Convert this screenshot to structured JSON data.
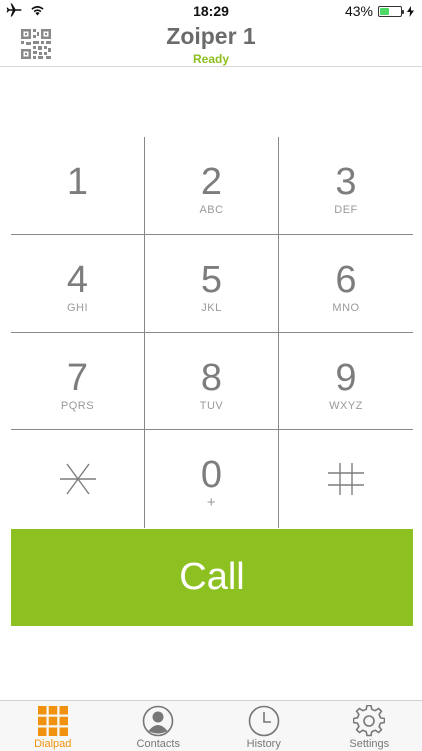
{
  "status_bar": {
    "time": "18:29",
    "battery_percent": "43%",
    "battery_level": 0.43,
    "icons": [
      "airplane-icon",
      "wifi-icon",
      "battery-icon",
      "charging-bolt-icon"
    ]
  },
  "header": {
    "title": "Zoiper 1",
    "status": "Ready",
    "status_color": "#8dbf1f",
    "left_icon": "qr-code-icon"
  },
  "dialpad": {
    "keys": [
      {
        "digit": "1",
        "letters": ""
      },
      {
        "digit": "2",
        "letters": "ABC"
      },
      {
        "digit": "3",
        "letters": "DEF"
      },
      {
        "digit": "4",
        "letters": "GHI"
      },
      {
        "digit": "5",
        "letters": "JKL"
      },
      {
        "digit": "6",
        "letters": "MNO"
      },
      {
        "digit": "7",
        "letters": "PQRS"
      },
      {
        "digit": "8",
        "letters": "TUV"
      },
      {
        "digit": "9",
        "letters": "WXYZ"
      },
      {
        "digit": "*",
        "letters": ""
      },
      {
        "digit": "0",
        "letters": "+"
      },
      {
        "digit": "#",
        "letters": ""
      }
    ]
  },
  "call_button": {
    "label": "Call",
    "color": "#8dc021"
  },
  "tabs": [
    {
      "label": "Dialpad",
      "icon": "dialpad-icon",
      "active": true
    },
    {
      "label": "Contacts",
      "icon": "contacts-icon",
      "active": false
    },
    {
      "label": "History",
      "icon": "history-clock-icon",
      "active": false
    },
    {
      "label": "Settings",
      "icon": "settings-gear-icon",
      "active": false
    }
  ],
  "colors": {
    "accent_active_tab": "#f0920f"
  }
}
